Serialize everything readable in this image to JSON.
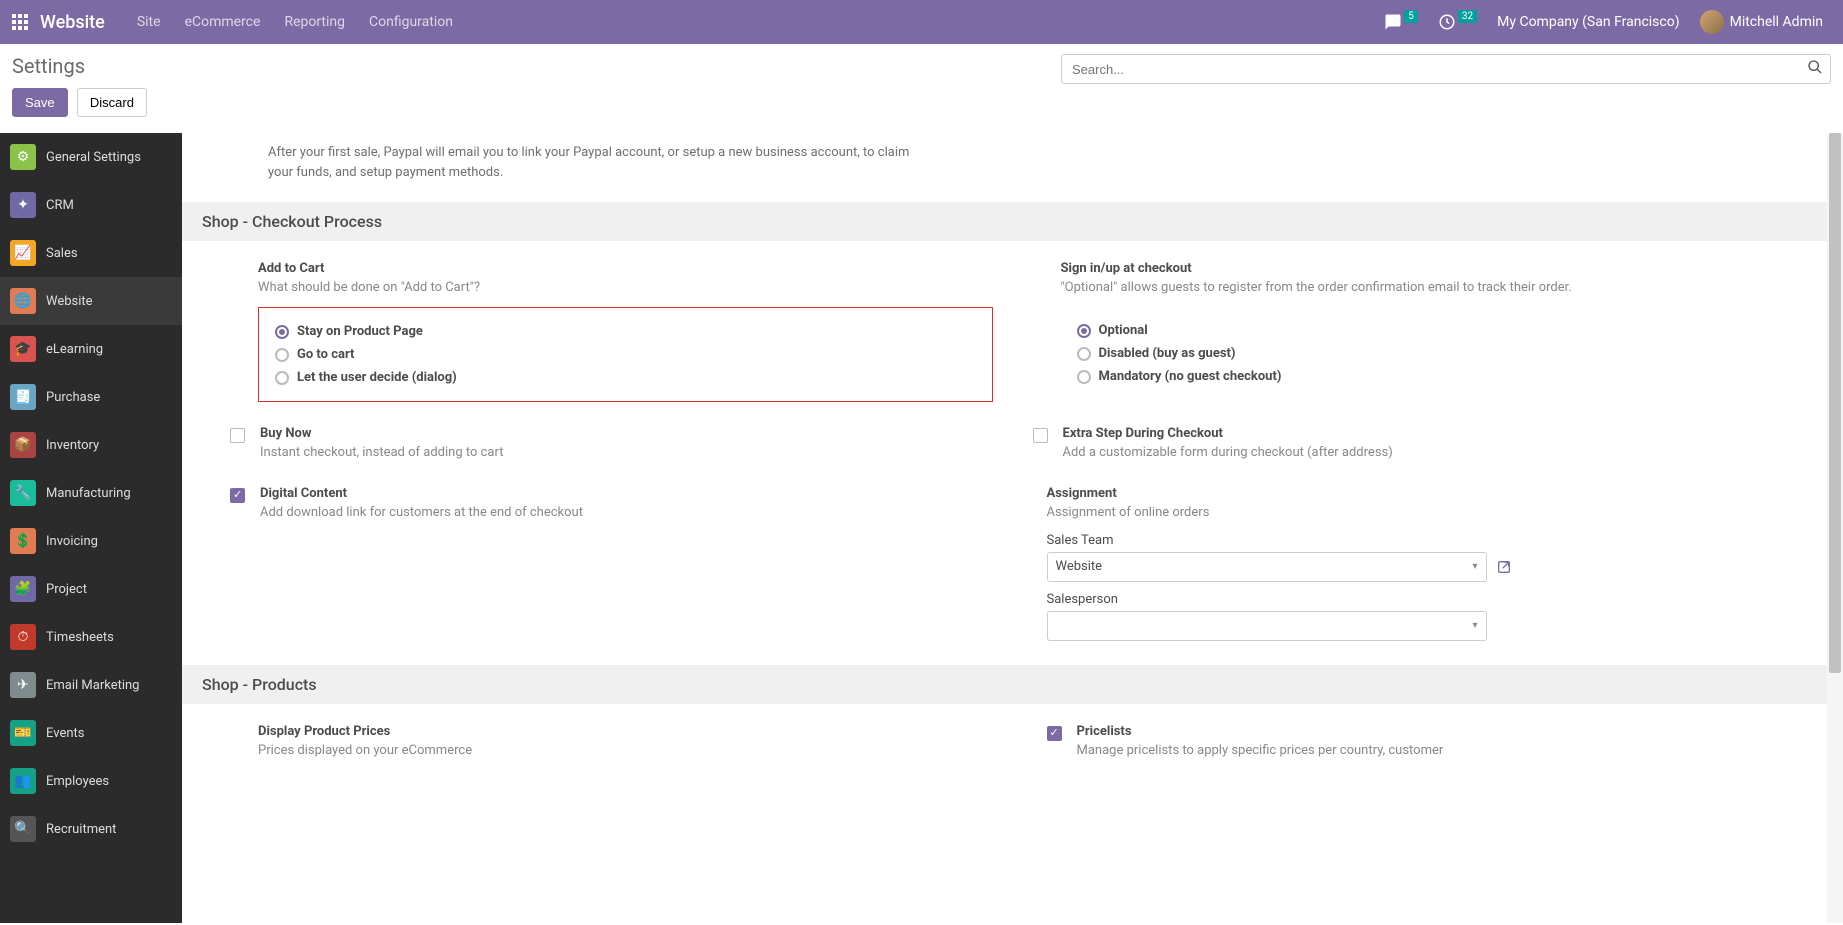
{
  "topnav": {
    "brand": "Website",
    "items": [
      "Site",
      "eCommerce",
      "Reporting",
      "Configuration"
    ],
    "msg_count": "5",
    "activity_count": "32",
    "company": "My Company (San Francisco)",
    "user": "Mitchell Admin"
  },
  "header": {
    "title": "Settings",
    "search_placeholder": "Search..."
  },
  "actions": {
    "save": "Save",
    "discard": "Discard"
  },
  "sidebar": {
    "items": [
      {
        "label": "General Settings",
        "color": "#8bc34a",
        "glyph": "⚙"
      },
      {
        "label": "CRM",
        "color": "#6f6aa5",
        "glyph": "✦"
      },
      {
        "label": "Sales",
        "color": "#f5a623",
        "glyph": "📈"
      },
      {
        "label": "Website",
        "color": "#e07b53",
        "glyph": "🌐",
        "active": true
      },
      {
        "label": "eLearning",
        "color": "#d9534f",
        "glyph": "🎓"
      },
      {
        "label": "Purchase",
        "color": "#6aa6c4",
        "glyph": "🧾"
      },
      {
        "label": "Inventory",
        "color": "#a94442",
        "glyph": "📦"
      },
      {
        "label": "Manufacturing",
        "color": "#1abc9c",
        "glyph": "🔧"
      },
      {
        "label": "Invoicing",
        "color": "#e07b53",
        "glyph": "💲"
      },
      {
        "label": "Project",
        "color": "#6f6aa5",
        "glyph": "🧩"
      },
      {
        "label": "Timesheets",
        "color": "#c0392b",
        "glyph": "⏱"
      },
      {
        "label": "Email Marketing",
        "color": "#7f8c8d",
        "glyph": "✈"
      },
      {
        "label": "Events",
        "color": "#16a085",
        "glyph": "🎫"
      },
      {
        "label": "Employees",
        "color": "#16a085",
        "glyph": "👥"
      },
      {
        "label": "Recruitment",
        "color": "#555",
        "glyph": "🔍"
      }
    ]
  },
  "intro": "After your first sale, Paypal will email you to link your Paypal account, or setup a new business account, to claim your funds, and setup payment methods.",
  "sections": {
    "checkout": {
      "title": "Shop - Checkout Process",
      "add_to_cart": {
        "title": "Add to Cart",
        "desc": "What should be done on \"Add to Cart\"?",
        "options": [
          "Stay on Product Page",
          "Go to cart",
          "Let the user decide (dialog)"
        ],
        "selected": 0
      },
      "signin": {
        "title": "Sign in/up at checkout",
        "desc": "\"Optional\" allows guests to register from the order confirmation email to track their order.",
        "options": [
          "Optional",
          "Disabled (buy as guest)",
          "Mandatory (no guest checkout)"
        ],
        "selected": 0
      },
      "buy_now": {
        "title": "Buy Now",
        "desc": "Instant checkout, instead of adding to cart",
        "checked": false
      },
      "extra_step": {
        "title": "Extra Step During Checkout",
        "desc": "Add a customizable form during checkout (after address)",
        "checked": false
      },
      "digital": {
        "title": "Digital Content",
        "desc": "Add download link for customers at the end of checkout",
        "checked": true
      },
      "assignment": {
        "title": "Assignment",
        "desc": "Assignment of online orders",
        "sales_team_label": "Sales Team",
        "sales_team_value": "Website",
        "salesperson_label": "Salesperson",
        "salesperson_value": ""
      }
    },
    "products": {
      "title": "Shop - Products",
      "display_prices": {
        "title": "Display Product Prices",
        "desc": "Prices displayed on your eCommerce"
      },
      "pricelists": {
        "title": "Pricelists",
        "desc": "Manage pricelists to apply specific prices per country, customer",
        "checked": true
      }
    }
  }
}
